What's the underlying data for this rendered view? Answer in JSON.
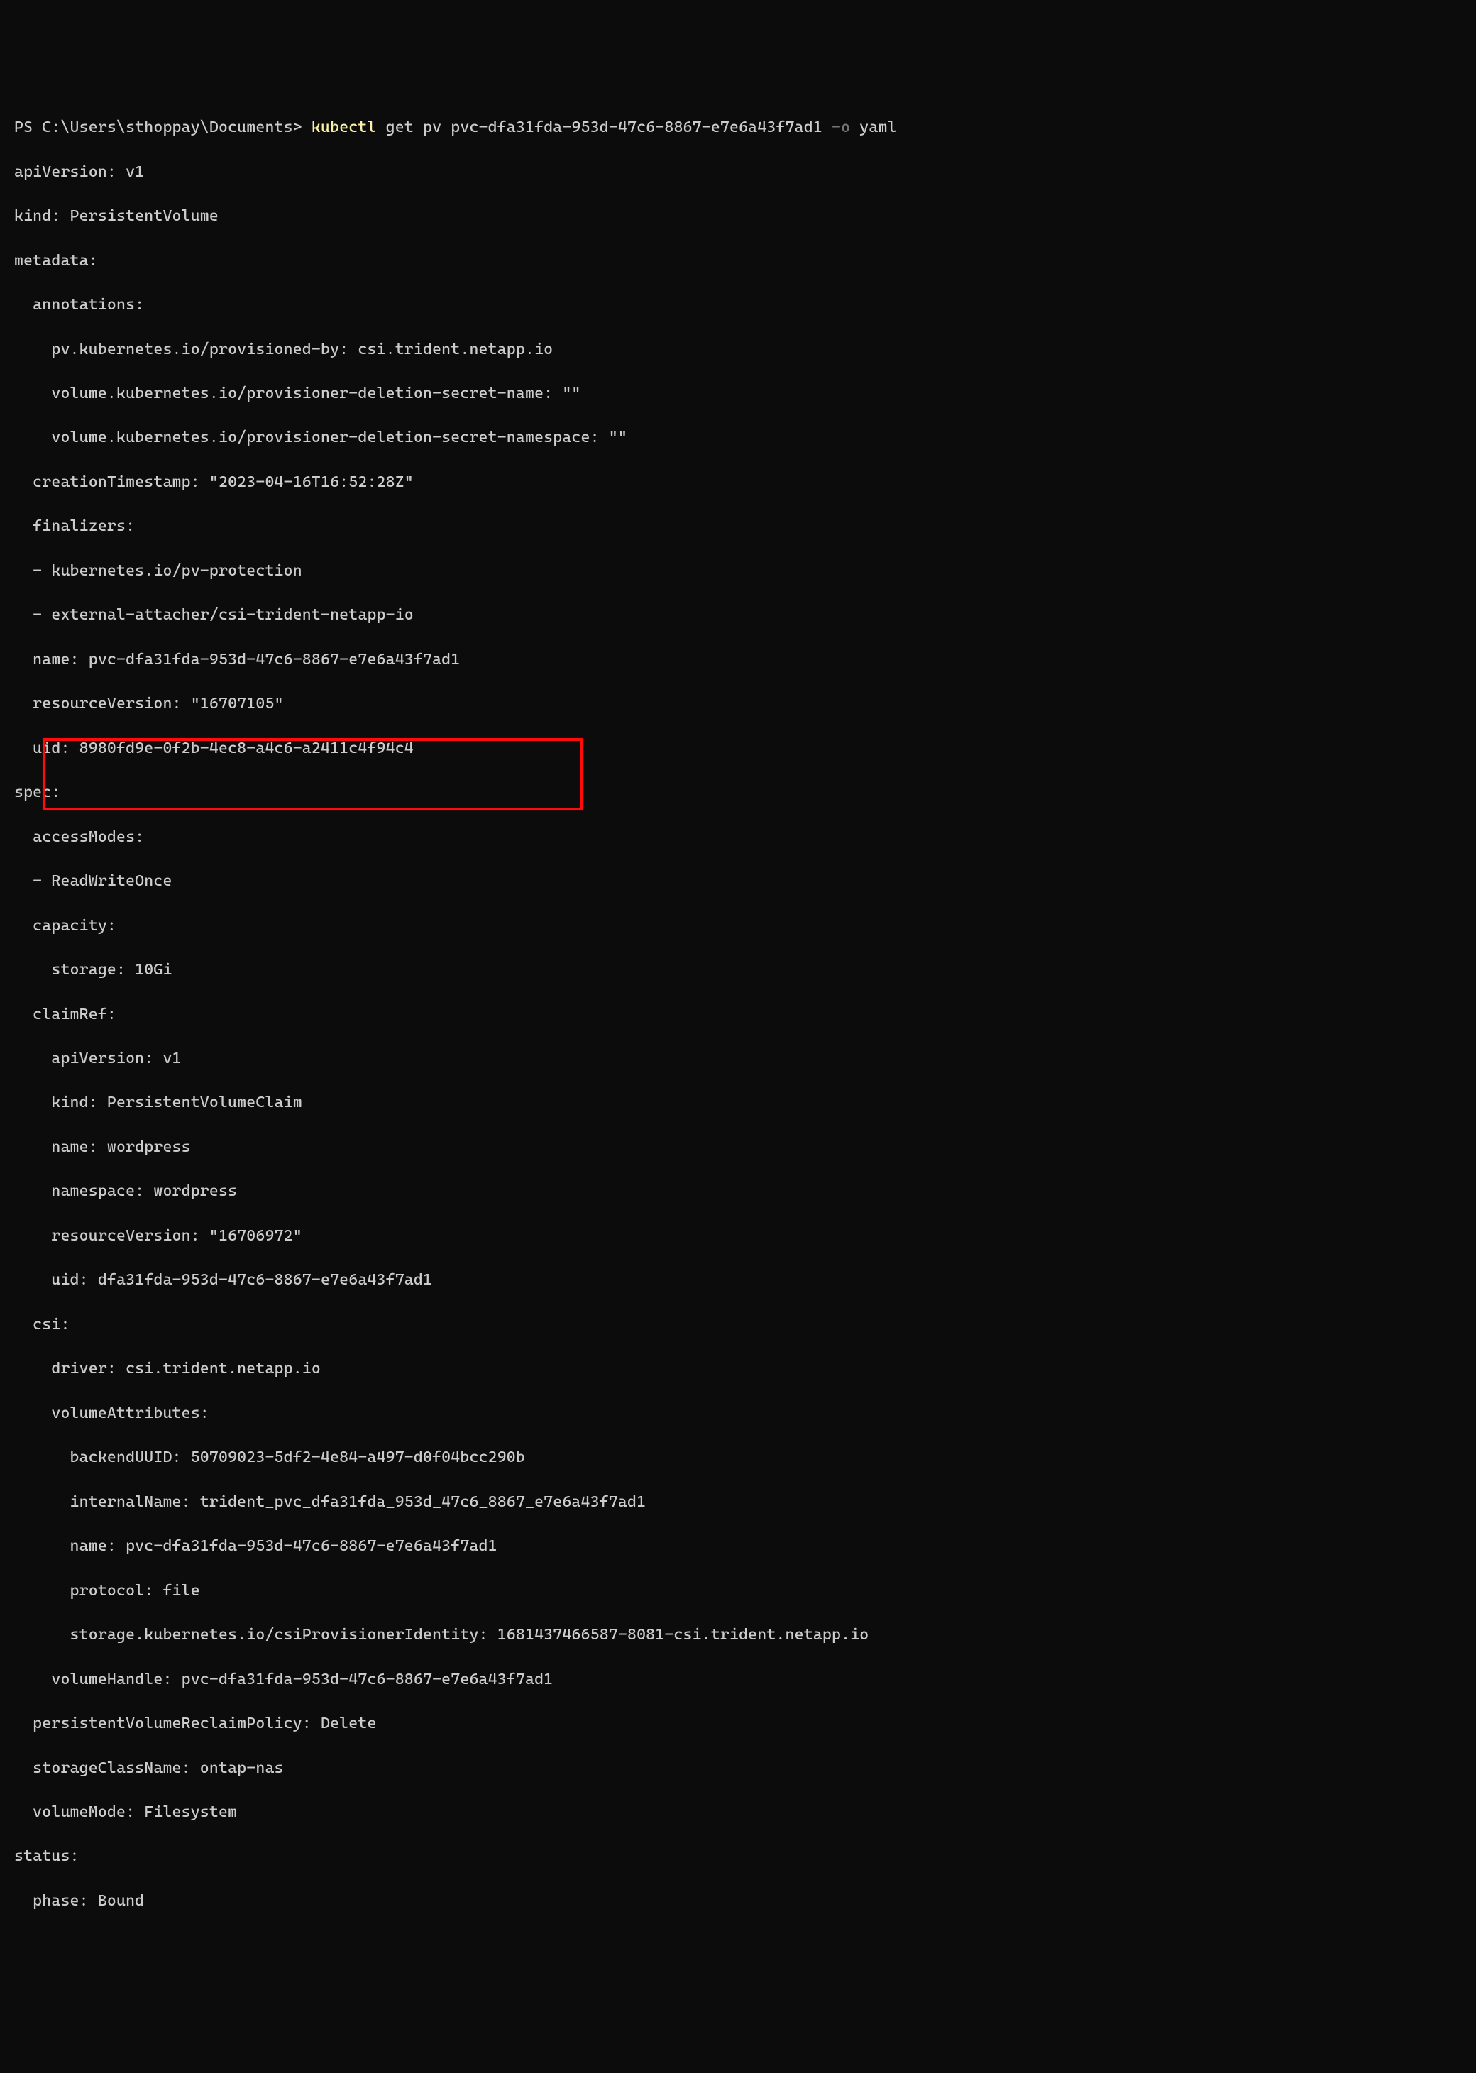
{
  "prompt": {
    "ps_prefix": "PS ",
    "path": "C:\\Users\\sthoppay\\Documents",
    "prompt_char": "> ",
    "command": "kubectl",
    "args": " get pv pvc-dfa31fda-953d-47c6-8867-e7e6a43f7ad1 ",
    "flag": "-o",
    "flag_arg": " yaml"
  },
  "yaml": {
    "l01": "apiVersion: v1",
    "l02": "kind: PersistentVolume",
    "l03": "metadata:",
    "l04": "  annotations:",
    "l05": "    pv.kubernetes.io/provisioned-by: csi.trident.netapp.io",
    "l06": "    volume.kubernetes.io/provisioner-deletion-secret-name: \"\"",
    "l07": "    volume.kubernetes.io/provisioner-deletion-secret-namespace: \"\"",
    "l08": "  creationTimestamp: \"2023-04-16T16:52:28Z\"",
    "l09": "  finalizers:",
    "l10": "  - kubernetes.io/pv-protection",
    "l11": "  - external-attacher/csi-trident-netapp-io",
    "l12": "  name: pvc-dfa31fda-953d-47c6-8867-e7e6a43f7ad1",
    "l13": "  resourceVersion: \"16707105\"",
    "l14": "  uid: 8980fd9e-0f2b-4ec8-a4c6-a2411c4f94c4",
    "l15": "spec:",
    "l16": "  accessModes:",
    "l17": "  - ReadWriteOnce",
    "l18": "  capacity:",
    "l19": "    storage: 10Gi",
    "l20": "  claimRef:",
    "l21": "    apiVersion: v1",
    "l22": "    kind: PersistentVolumeClaim",
    "l23": "    name: wordpress",
    "l24": "    namespace: wordpress",
    "l25": "    resourceVersion: \"16706972\"",
    "l26": "    uid: dfa31fda-953d-47c6-8867-e7e6a43f7ad1",
    "l27": "  csi:",
    "l28": "    driver: csi.trident.netapp.io",
    "l29": "    volumeAttributes:",
    "l30": "      backendUUID: 50709023-5df2-4e84-a497-d0f04bcc290b",
    "l31": "      internalName: trident_pvc_dfa31fda_953d_47c6_8867_e7e6a43f7ad1",
    "l32": "      name: pvc-dfa31fda-953d-47c6-8867-e7e6a43f7ad1",
    "l33": "      protocol: file",
    "l34": "      storage.kubernetes.io/csiProvisionerIdentity: 1681437466587-8081-csi.trident.netapp.io",
    "l35": "    volumeHandle: pvc-dfa31fda-953d-47c6-8867-e7e6a43f7ad1",
    "l36": "  persistentVolumeReclaimPolicy: Delete",
    "l37": "  storageClassName: ontap-nas",
    "l38": "  volumeMode: Filesystem",
    "l39": "status:",
    "l40": "  phase: Bound"
  },
  "highlight": {
    "description": "volumeAttributes backendUUID and internalName"
  }
}
